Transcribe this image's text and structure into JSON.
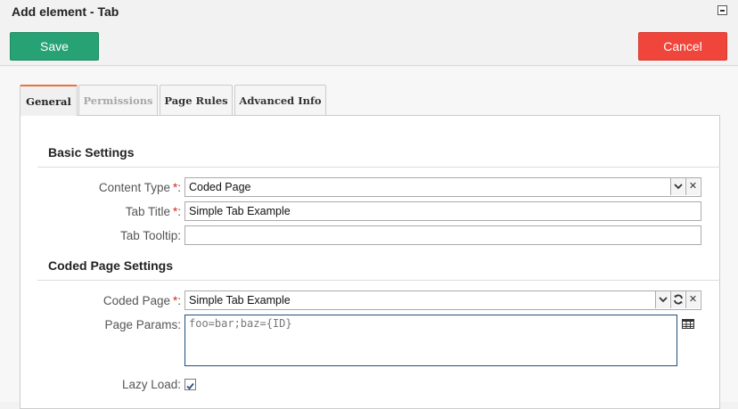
{
  "window": {
    "title": "Add element - Tab"
  },
  "toolbar": {
    "save_label": "Save",
    "cancel_label": "Cancel"
  },
  "tabs": [
    {
      "label": "General",
      "state": "active"
    },
    {
      "label": "Permissions",
      "state": "disabled"
    },
    {
      "label": "Page Rules",
      "state": "normal"
    },
    {
      "label": "Advanced Info",
      "state": "normal"
    }
  ],
  "basic_settings": {
    "title": "Basic Settings",
    "content_type": {
      "label": "Content Type",
      "required_mark": "*",
      "value": "Coded Page"
    },
    "tab_title": {
      "label": "Tab Title",
      "required_mark": "*",
      "value": "Simple Tab Example"
    },
    "tab_tooltip": {
      "label": "Tab Tooltip:",
      "value": ""
    }
  },
  "coded_page_settings": {
    "title": "Coded Page Settings",
    "coded_page": {
      "label": "Coded Page",
      "required_mark": "*",
      "value": "Simple Tab Example"
    },
    "page_params": {
      "label": "Page Params:",
      "value": "foo=bar;baz={ID}"
    },
    "lazy_load": {
      "label": "Lazy Load:",
      "checked": true
    }
  },
  "colors": {
    "save": "#27a275",
    "cancel": "#f0453a",
    "active_tab_accent": "#e8743b",
    "required": "#d9251c"
  },
  "icons": {
    "minimize": "minimize-icon",
    "dropdown": "chevron-down-icon",
    "clear": "close-icon",
    "refresh": "refresh-icon",
    "params_editor": "table-grid-icon",
    "checkbox": "checkmark-icon"
  }
}
